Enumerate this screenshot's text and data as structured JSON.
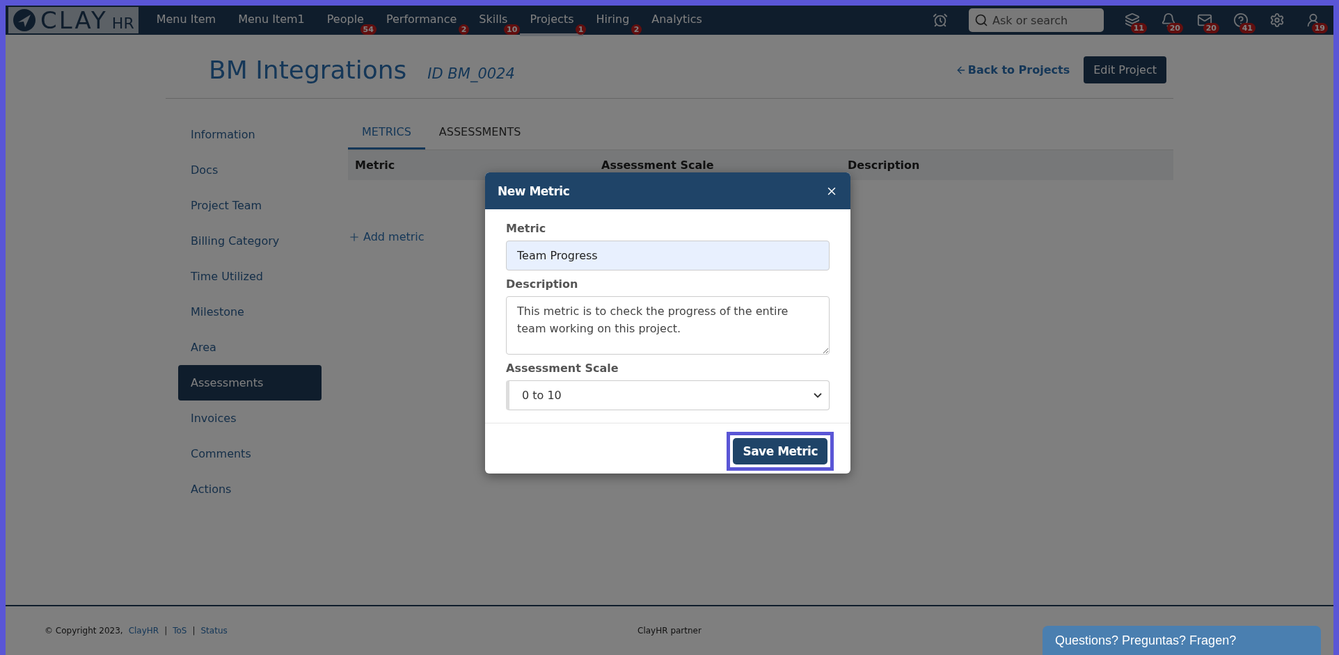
{
  "brand": {
    "name": "CLAY",
    "suffix": "HR"
  },
  "nav": [
    {
      "label": "Menu Item",
      "selected": false
    },
    {
      "label": "Menu Item1",
      "selected": false
    },
    {
      "label": "People",
      "badge": "54",
      "selected": false
    },
    {
      "label": "Performance",
      "badge": "2",
      "selected": false
    },
    {
      "label": "Skills",
      "badge": "10",
      "selected": false
    },
    {
      "label": "Projects",
      "badge": "1",
      "selected": true
    },
    {
      "label": "Hiring",
      "badge": "2",
      "selected": false
    },
    {
      "label": "Analytics",
      "selected": false
    }
  ],
  "search": {
    "placeholder": "Ask or search"
  },
  "toolbar": [
    {
      "kind": "alarm"
    },
    {
      "kind": "search"
    },
    {
      "kind": "layers",
      "badge": "11"
    },
    {
      "kind": "bell",
      "badge": "20"
    },
    {
      "kind": "mail",
      "badge": "20"
    },
    {
      "kind": "help",
      "badge": "41"
    },
    {
      "kind": "gear"
    },
    {
      "kind": "avatar",
      "badge": "19"
    }
  ],
  "project": {
    "title": "BM Integrations",
    "id": "ID BM_0024",
    "back": "Back to Projects",
    "edit": "Edit Project"
  },
  "sidebar": [
    {
      "label": "Information",
      "selected": false
    },
    {
      "label": "Docs",
      "selected": false
    },
    {
      "label": "Project Team",
      "selected": false
    },
    {
      "label": "Billing Category",
      "selected": false
    },
    {
      "label": "Time Utilized",
      "selected": false
    },
    {
      "label": "Milestone",
      "selected": false
    },
    {
      "label": "Area",
      "selected": false
    },
    {
      "label": "Assessments",
      "selected": true
    },
    {
      "label": "Invoices",
      "selected": false
    },
    {
      "label": "Comments",
      "selected": false
    },
    {
      "label": "Actions",
      "selected": false
    }
  ],
  "tabs": [
    {
      "label": "METRICS",
      "selected": true
    },
    {
      "label": "ASSESSMENTS",
      "selected": false
    }
  ],
  "table": {
    "columns": [
      "Metric",
      "Assessment Scale",
      "Description"
    ]
  },
  "add_metric": "Add metric",
  "modal": {
    "title": "New Metric",
    "fields": [
      {
        "kind": "input",
        "label": "Metric",
        "value": "Team Progress"
      },
      {
        "kind": "textarea",
        "label": "Description",
        "value": "This metric is to check the progress of the entire team working on this project."
      },
      {
        "kind": "select",
        "label": "Assessment Scale",
        "value": "0 to 10"
      }
    ],
    "save": "Save Metric",
    "save_highlighted": true
  },
  "footer": {
    "copyright": "© Copyright 2023,",
    "links": [
      "ClayHR",
      "ToS",
      "Status"
    ],
    "separator": "|",
    "center": "ClayHR partner"
  },
  "chat": "Questions? Preguntas? Fragen?"
}
